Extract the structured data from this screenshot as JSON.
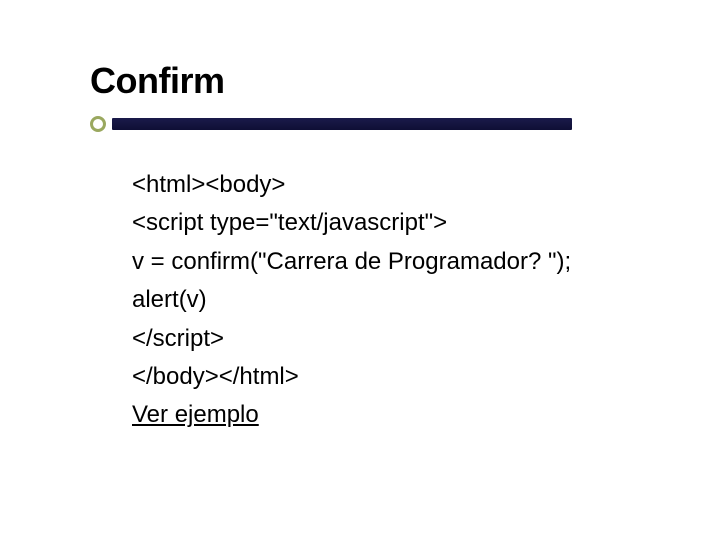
{
  "slide": {
    "title": "Confirm",
    "code": {
      "line1": "<html><body>",
      "line2": "<script type=\"text/javascript\">",
      "line3": "v = confirm(\"Carrera de Programador? \");",
      "line4": "alert(v)",
      "line5": "</script>",
      "line6": "</body></html>"
    },
    "link_label": "Ver ejemplo"
  }
}
